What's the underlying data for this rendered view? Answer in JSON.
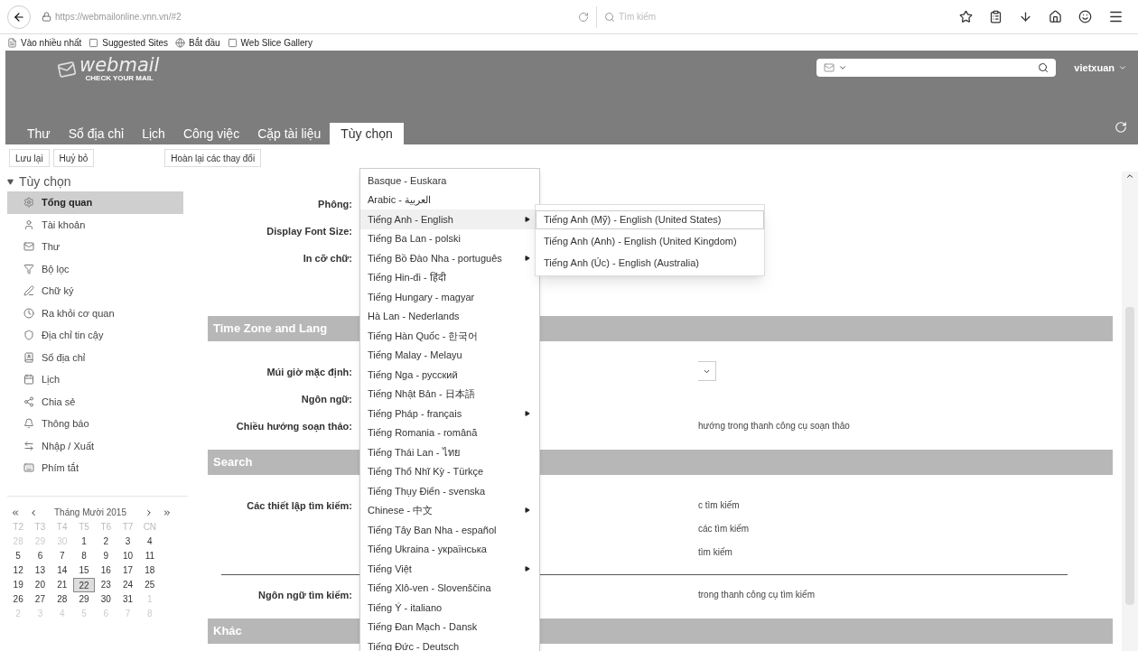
{
  "browser": {
    "url": "https://webmailonline.vnn.vn/#2",
    "search_placeholder": "Tìm kiếm",
    "bookmarks": [
      "Vào nhiều nhất",
      "Suggested Sites",
      "Bắt đầu",
      "Web Slice Gallery"
    ]
  },
  "header": {
    "logo": "webmail",
    "tagline": "CHECK YOUR MAIL",
    "user": "vietxuan",
    "tabs": [
      {
        "label": "Thư",
        "selected": false
      },
      {
        "label": "Sổ địa chỉ",
        "selected": false
      },
      {
        "label": "Lịch",
        "selected": false
      },
      {
        "label": "Công việc",
        "selected": false
      },
      {
        "label": "Cặp tài liệu",
        "selected": false
      },
      {
        "label": "Tùy chọn",
        "selected": true
      }
    ]
  },
  "toolbar": {
    "left": [
      "Lưu lại",
      "Huỷ bỏ"
    ],
    "right": [
      "Hoàn lại các thay đổi"
    ]
  },
  "sidebar": {
    "root": "Tùy chọn",
    "expanded": true,
    "items": [
      {
        "label": "Tổng quan",
        "selected": true
      },
      {
        "label": "Tài khoản",
        "selected": false
      },
      {
        "label": "Thư",
        "selected": false
      },
      {
        "label": "Bộ lọc",
        "selected": false
      },
      {
        "label": "Chữ ký",
        "selected": false
      },
      {
        "label": "Ra khỏi cơ quan",
        "selected": false
      },
      {
        "label": "Địa chỉ tin cậy",
        "selected": false
      },
      {
        "label": "Sổ địa chỉ",
        "selected": false
      },
      {
        "label": "Lịch",
        "selected": false
      },
      {
        "label": "Chia sẻ",
        "selected": false
      },
      {
        "label": "Thông báo",
        "selected": false
      },
      {
        "label": "Nhập / Xuất",
        "selected": false
      },
      {
        "label": "Phím tắt",
        "selected": false
      }
    ]
  },
  "calendar": {
    "title": "Tháng Mười 2015",
    "weekdays": [
      "T2",
      "T3",
      "T4",
      "T5",
      "T6",
      "T7",
      "CN"
    ],
    "days": [
      {
        "text": "28",
        "in_month": false,
        "selected": false
      },
      {
        "text": "29",
        "in_month": false,
        "selected": false
      },
      {
        "text": "30",
        "in_month": false,
        "selected": false
      },
      {
        "text": "1",
        "in_month": true,
        "selected": false
      },
      {
        "text": "2",
        "in_month": true,
        "selected": false
      },
      {
        "text": "3",
        "in_month": true,
        "selected": false
      },
      {
        "text": "4",
        "in_month": true,
        "selected": false
      },
      {
        "text": "5",
        "in_month": true,
        "selected": false
      },
      {
        "text": "6",
        "in_month": true,
        "selected": false
      },
      {
        "text": "7",
        "in_month": true,
        "selected": false
      },
      {
        "text": "8",
        "in_month": true,
        "selected": false
      },
      {
        "text": "9",
        "in_month": true,
        "selected": false
      },
      {
        "text": "10",
        "in_month": true,
        "selected": false
      },
      {
        "text": "11",
        "in_month": true,
        "selected": false
      },
      {
        "text": "12",
        "in_month": true,
        "selected": false
      },
      {
        "text": "13",
        "in_month": true,
        "selected": false
      },
      {
        "text": "14",
        "in_month": true,
        "selected": false
      },
      {
        "text": "15",
        "in_month": true,
        "selected": false
      },
      {
        "text": "16",
        "in_month": true,
        "selected": false
      },
      {
        "text": "17",
        "in_month": true,
        "selected": false
      },
      {
        "text": "18",
        "in_month": true,
        "selected": false
      },
      {
        "text": "19",
        "in_month": true,
        "selected": false
      },
      {
        "text": "20",
        "in_month": true,
        "selected": false
      },
      {
        "text": "21",
        "in_month": true,
        "selected": false
      },
      {
        "text": "22",
        "in_month": true,
        "selected": true
      },
      {
        "text": "23",
        "in_month": true,
        "selected": false
      },
      {
        "text": "24",
        "in_month": true,
        "selected": false
      },
      {
        "text": "25",
        "in_month": true,
        "selected": false
      },
      {
        "text": "26",
        "in_month": true,
        "selected": false
      },
      {
        "text": "27",
        "in_month": true,
        "selected": false
      },
      {
        "text": "28",
        "in_month": true,
        "selected": false
      },
      {
        "text": "29",
        "in_month": true,
        "selected": false
      },
      {
        "text": "30",
        "in_month": true,
        "selected": false
      },
      {
        "text": "31",
        "in_month": true,
        "selected": false
      },
      {
        "text": "1",
        "in_month": false,
        "selected": false
      },
      {
        "text": "2",
        "in_month": false,
        "selected": false
      },
      {
        "text": "3",
        "in_month": false,
        "selected": false
      },
      {
        "text": "4",
        "in_month": false,
        "selected": false
      },
      {
        "text": "5",
        "in_month": false,
        "selected": false
      },
      {
        "text": "6",
        "in_month": false,
        "selected": false
      },
      {
        "text": "7",
        "in_month": false,
        "selected": false
      },
      {
        "text": "8",
        "in_month": false,
        "selected": false
      }
    ]
  },
  "sections": [
    {
      "rows": [
        {
          "kind": "plain",
          "label": "Phông:"
        },
        {
          "kind": "plain",
          "label": "Display Font Size:"
        },
        {
          "kind": "plain",
          "label": "In cỡ chữ:"
        }
      ]
    },
    {
      "title": "Time Zone and Lang",
      "rows": [
        {
          "kind": "select",
          "label": "Múi giờ mặc định:"
        },
        {
          "kind": "plain",
          "label": "Ngôn ngữ:"
        },
        {
          "kind": "plain",
          "label": "Chiều hướng soạn thảo:",
          "values": [
            "hướng trong thanh công cụ soạn thảo"
          ]
        }
      ]
    },
    {
      "title": "Search",
      "rows": [
        {
          "kind": "plain",
          "label": "Các thiết lập tìm kiếm:",
          "values": [
            "c tìm kiếm",
            "các tìm kiếm",
            "tìm kiếm"
          ]
        },
        {
          "kind": "divider"
        },
        {
          "kind": "plain",
          "label": "Ngôn ngữ tìm kiếm:",
          "values": [
            "trong thanh công cụ tìm kiếm"
          ]
        }
      ]
    },
    {
      "title": "Khác"
    }
  ],
  "language_menu": {
    "items": [
      {
        "label": "Basque - Euskara",
        "has_submenu": false,
        "expanded": false
      },
      {
        "label": "Arabic - العربية",
        "has_submenu": false,
        "expanded": false
      },
      {
        "label": "Tiếng Anh - English",
        "has_submenu": true,
        "expanded": true
      },
      {
        "label": "Tiếng Ba Lan - polski",
        "has_submenu": false,
        "expanded": false
      },
      {
        "label": "Tiếng Bồ Đào Nha - português",
        "has_submenu": true,
        "expanded": false
      },
      {
        "label": "Tiếng Hin-đi - हिंदी",
        "has_submenu": false,
        "expanded": false
      },
      {
        "label": "Tiếng Hungary - magyar",
        "has_submenu": false,
        "expanded": false
      },
      {
        "label": "Hà Lan - Nederlands",
        "has_submenu": false,
        "expanded": false
      },
      {
        "label": "Tiếng Hàn Quốc - 한국어",
        "has_submenu": false,
        "expanded": false
      },
      {
        "label": "Tiếng Malay - Melayu",
        "has_submenu": false,
        "expanded": false
      },
      {
        "label": "Tiếng Nga - русский",
        "has_submenu": false,
        "expanded": false
      },
      {
        "label": "Tiếng Nhật Bản - 日本語",
        "has_submenu": false,
        "expanded": false
      },
      {
        "label": "Tiếng Pháp - français",
        "has_submenu": true,
        "expanded": false
      },
      {
        "label": "Tiếng Romania - română",
        "has_submenu": false,
        "expanded": false
      },
      {
        "label": "Tiếng Thái Lan - ไทย",
        "has_submenu": false,
        "expanded": false
      },
      {
        "label": "Tiếng Thổ Nhĩ Kỳ - Türkçe",
        "has_submenu": false,
        "expanded": false
      },
      {
        "label": "Tiếng Thụy Điển - svenska",
        "has_submenu": false,
        "expanded": false
      },
      {
        "label": "Chinese - 中文",
        "has_submenu": true,
        "expanded": false
      },
      {
        "label": "Tiếng Tây Ban Nha - español",
        "has_submenu": false,
        "expanded": false
      },
      {
        "label": "Tiếng Ukraina - українська",
        "has_submenu": false,
        "expanded": false
      },
      {
        "label": "Tiếng Việt",
        "has_submenu": true,
        "expanded": false
      },
      {
        "label": "Tiếng Xlô-ven - Slovenščina",
        "has_submenu": false,
        "expanded": false
      },
      {
        "label": "Tiếng Ý - italiano",
        "has_submenu": false,
        "expanded": false
      },
      {
        "label": "Tiếng Đan Mạch - Dansk",
        "has_submenu": false,
        "expanded": false
      },
      {
        "label": "Tiếng Đức - Deutsch",
        "has_submenu": false,
        "expanded": false
      }
    ],
    "submenu": [
      {
        "label": "Tiếng Anh (Mỹ) - English (United States)",
        "selected": true
      },
      {
        "label": "Tiếng Anh (Anh) - English (United Kingdom)",
        "selected": false
      },
      {
        "label": "Tiếng Anh (Úc) - English (Australia)",
        "selected": false
      }
    ]
  }
}
